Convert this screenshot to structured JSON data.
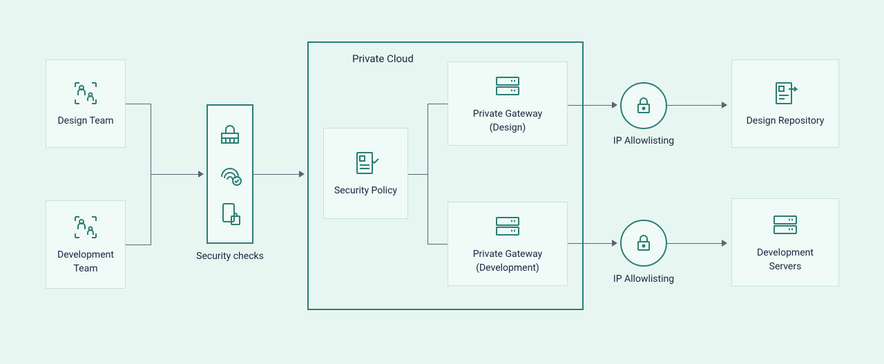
{
  "teams": {
    "design": {
      "label": "Design Team"
    },
    "development": {
      "label": "Development Team"
    }
  },
  "security_checks": {
    "label": "Security checks"
  },
  "private_cloud": {
    "title": "Private Cloud",
    "security_policy": {
      "label": "Security Policy"
    },
    "gateway_design": {
      "label": "Private Gateway (Design)"
    },
    "gateway_dev": {
      "label": "Private Gateway (Development)"
    }
  },
  "ip_allowlisting": {
    "top": {
      "label": "IP Allowlisting"
    },
    "bottom": {
      "label": "IP Allowlisting"
    }
  },
  "destinations": {
    "design_repo": {
      "label": "Design Repository"
    },
    "dev_servers": {
      "label": "Development Servers"
    }
  }
}
